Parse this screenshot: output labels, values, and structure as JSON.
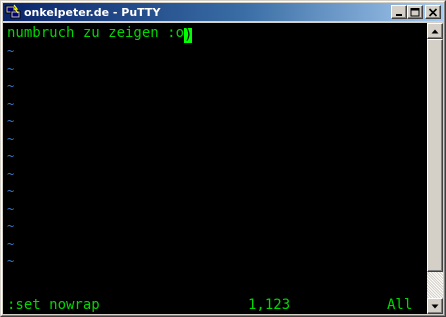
{
  "window": {
    "title": "onkelpeter.de - PuTTY",
    "app_icon": "putty-terminal-icon",
    "buttons": {
      "minimize_icon": "minimize-icon",
      "maximize_icon": "maximize-icon",
      "close_icon": "close-icon"
    }
  },
  "terminal": {
    "first_line_text": "numbruch zu zeigen :o",
    "cursor_char": ")",
    "empty_line_marker": "~",
    "empty_line_count": 13,
    "status": {
      "command": ":set nowrap",
      "position": "1,123",
      "scroll": "All"
    },
    "colors": {
      "background": "#000000",
      "text": "#00d800",
      "tilde": "#3a78c8",
      "cursor": "#00ff00"
    }
  },
  "scrollbar": {
    "up_icon": "scroll-up-arrow-icon",
    "down_icon": "scroll-down-arrow-icon",
    "thumb_fraction": 0.9
  }
}
